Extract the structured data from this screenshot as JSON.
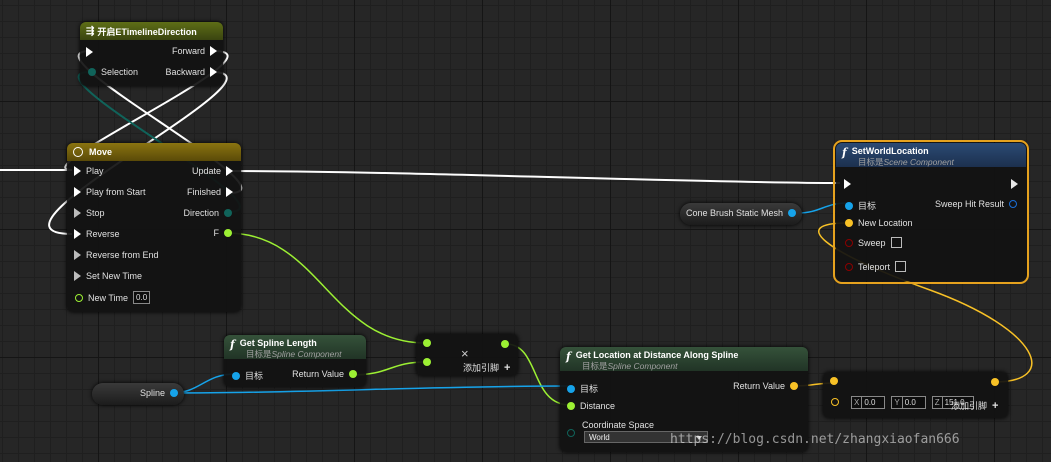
{
  "nodes": {
    "timeline_direction": {
      "title": "开启ETimelineDirection",
      "pins": {
        "selection": "Selection",
        "forward": "Forward",
        "backward": "Backward"
      }
    },
    "move": {
      "title": "Move",
      "inputs": [
        "Play",
        "Play from Start",
        "Stop",
        "Reverse",
        "Reverse from End",
        "Set New Time"
      ],
      "new_time_label": "New Time",
      "new_time_value": "0.0",
      "outputs": {
        "update": "Update",
        "finished": "Finished",
        "direction": "Direction",
        "f": "F"
      }
    },
    "set_world_location": {
      "title": "SetWorldLocation",
      "subtitle_prefix": "目标是",
      "subtitle_class": "Scene Component",
      "pins": {
        "target": "目标",
        "new_location": "New Location",
        "sweep": "Sweep",
        "teleport": "Teleport",
        "sweep_hit_result": "Sweep Hit Result"
      }
    },
    "cone_brush": {
      "label": "Cone Brush Static Mesh"
    },
    "spline_var": {
      "label": "Spline"
    },
    "get_spline_length": {
      "title": "Get Spline Length",
      "subtitle_prefix": "目标是",
      "subtitle_class": "Spline Component",
      "pins": {
        "target": "目标",
        "return_value": "Return Value"
      }
    },
    "multiply": {
      "symbol": "×",
      "add_pin": "添加引脚",
      "plus": "+"
    },
    "get_location_along": {
      "title": "Get Location at Distance Along Spline",
      "subtitle_prefix": "目标是",
      "subtitle_class": "Spline Component",
      "pins": {
        "target": "目标",
        "distance": "Distance",
        "coordinate_space": "Coordinate Space",
        "return_value": "Return Value"
      },
      "coordinate_space_value": "World"
    },
    "add_vector": {
      "x_label": "X",
      "x_value": "0.0",
      "y_label": "Y",
      "y_value": "0.0",
      "z_label": "Z",
      "z_value": "151.0",
      "add_pin": "添加引脚",
      "plus": "+"
    }
  },
  "watermark": "https://blog.csdn.net/zhangxiaofan666",
  "colors": {
    "exec": "#ffffff",
    "object": "#16a3ea",
    "float": "#9cf033",
    "vector": "#f8c126",
    "enum": "#10635a",
    "bool": "#8b0000",
    "struct": "#0d4fa8",
    "header_enum": "#4a5a10",
    "header_timeline": "#7d6a10",
    "header_function": "#2d4a32",
    "selected_outline": "#e6a21e"
  },
  "icons": {
    "enum_switch": "switch-icon",
    "timeline": "clock-icon",
    "function": "function-icon"
  }
}
